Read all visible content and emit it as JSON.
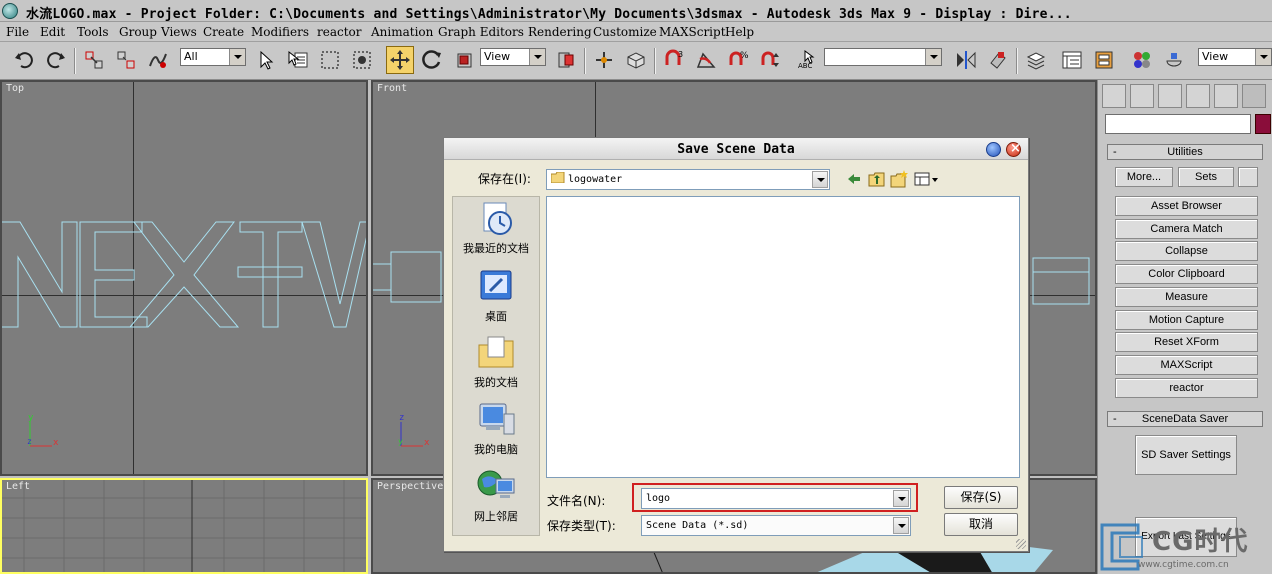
{
  "window": {
    "title": "水流LOGO.max     - Project Folder: C:\\Documents and Settings\\Administrator\\My Documents\\3dsmax     - Autodesk 3ds Max 9     - Display : Dire..."
  },
  "menu": [
    "File",
    "Edit",
    "Tools",
    "Group",
    "Views",
    "Create",
    "Modifiers",
    "reactor",
    "Animation",
    "Graph Editors",
    "Rendering",
    "Customize",
    "MAXScript",
    "Help"
  ],
  "toolbar": {
    "selection_filter": "All",
    "ref_coord": "View",
    "named_selection": "",
    "ref_coord_2": "View",
    "abc_label": "ABC"
  },
  "viewports": {
    "top_label": "Top",
    "front_label": "Front",
    "left_label": "Left",
    "perspective_label": "Perspective",
    "axis_y": "y",
    "axis_x": "x",
    "axis_z": "z"
  },
  "command_panel": {
    "object_name": "",
    "object_color": "#8a0d3a",
    "utilities_header": "Utilities",
    "more_label": "More...",
    "sets_label": "Sets",
    "utility_buttons": [
      "Asset Browser",
      "Camera Match",
      "Collapse",
      "Color Clipboard",
      "Measure",
      "Motion Capture",
      "Reset XForm",
      "MAXScript",
      "reactor"
    ],
    "scenedata_header": "SceneData Saver",
    "sd_settings_label": "SD Saver Settings",
    "export_label": "Export Last Settings"
  },
  "dialog": {
    "title": "Save Scene Data",
    "save_in_label": "保存在(I):",
    "save_in_value": "logowater",
    "places": [
      "我最近的文档",
      "桌面",
      "我的文档",
      "我的电脑",
      "网上邻居"
    ],
    "filename_label": "文件名(N):",
    "filename_value": "logo",
    "filetype_label": "保存类型(T):",
    "filetype_value": "Scene Data (*.sd)",
    "save_button": "保存(S)",
    "cancel_button": "取消"
  },
  "watermark": {
    "brand": "CG时代",
    "url": "www.cgtime.com.cn"
  },
  "colors": {
    "accent_yellow": "#f5d36a",
    "wireframe": "#a8e0f0",
    "highlight_red": "#d02020"
  }
}
